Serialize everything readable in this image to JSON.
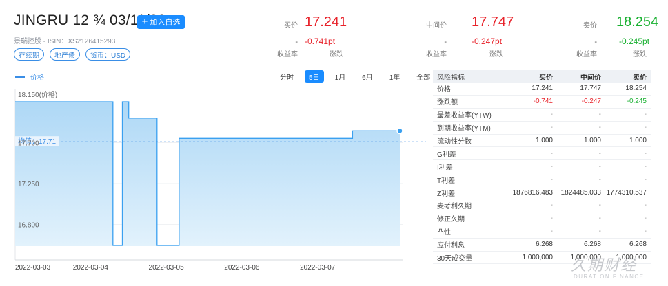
{
  "header": {
    "title": "JINGRU 12 ¾ 03/11/22",
    "add_button_label": "加入自选",
    "issuer_line": "景瑞控股 - ISIN：XS2126415293",
    "tags": [
      "存续期",
      "地产债",
      "货币：USD"
    ]
  },
  "quotes": [
    {
      "label": "买价",
      "price": "17.241",
      "dash": "-",
      "change": "-0.741pt",
      "yield_label": "收益率",
      "change_label": "涨跌",
      "color": "#e8222a"
    },
    {
      "label": "中间价",
      "price": "17.747",
      "dash": "-",
      "change": "-0.247pt",
      "yield_label": "收益率",
      "change_label": "涨跌",
      "color": "#e8222a"
    },
    {
      "label": "卖价",
      "price": "18.254",
      "dash": "-",
      "change": "-0.245pt",
      "yield_label": "收益率",
      "change_label": "涨跌",
      "color": "#18b030"
    }
  ],
  "chart_controls": {
    "legend_label": "价格",
    "ranges": [
      "分时",
      "5日",
      "1月",
      "6月",
      "1年",
      "全部"
    ],
    "active_range": "5日"
  },
  "chart_data": {
    "type": "area",
    "series": [
      {
        "name": "价格",
        "points": [
          [
            "2022-03-03 00:00",
            18.15
          ],
          [
            "2022-03-04 07:00",
            18.15
          ],
          [
            "2022-03-04 07:00",
            16.57
          ],
          [
            "2022-03-04 10:00",
            16.57
          ],
          [
            "2022-03-04 10:00",
            18.15
          ],
          [
            "2022-03-04 12:00",
            18.15
          ],
          [
            "2022-03-04 12:00",
            17.97
          ],
          [
            "2022-03-04 21:00",
            17.97
          ],
          [
            "2022-03-04 21:00",
            16.57
          ],
          [
            "2022-03-05 04:00",
            16.57
          ],
          [
            "2022-03-05 04:00",
            17.747
          ],
          [
            "2022-03-07 11:00",
            17.747
          ],
          [
            "2022-03-07 11:00",
            17.83
          ],
          [
            "2022-03-08 02:00",
            17.83
          ]
        ]
      }
    ],
    "average": 17.71,
    "average_label": "均值：17.71",
    "y_top_label": "18.150(价格)",
    "y_ticks": [
      17.7,
      17.25,
      16.8
    ],
    "y_tick_labels": [
      "17.700",
      "17.250",
      "16.800"
    ],
    "ylim": [
      16.57,
      18.15
    ],
    "x_ticks": [
      "2022-03-03",
      "2022-03-04",
      "2022-03-05",
      "2022-03-06",
      "2022-03-07"
    ],
    "xlim": [
      "2022-03-03 00:00",
      "2022-03-08 02:00"
    ],
    "colors": {
      "line": "#3aa0f0",
      "fill_top": "#aed8f6",
      "fill_bottom": "#e2f2fc",
      "average": "#3a8ee6"
    }
  },
  "risk_table": {
    "headers": [
      "风险指标",
      "买价",
      "中间价",
      "卖价"
    ],
    "rows": [
      {
        "label": "价格",
        "buy": "17.241",
        "mid": "17.747",
        "sell": "18.254"
      },
      {
        "label": "涨跌额",
        "buy": "-0.741",
        "mid": "-0.247",
        "sell": "-0.245"
      },
      {
        "label": "最差收益率(YTW)",
        "buy": "-",
        "mid": "-",
        "sell": "-"
      },
      {
        "label": "到期收益率(YTM)",
        "buy": "-",
        "mid": "-",
        "sell": "-"
      },
      {
        "label": "流动性分数",
        "buy": "1.000",
        "mid": "1.000",
        "sell": "1.000"
      },
      {
        "label": "G利差",
        "buy": "-",
        "mid": "-",
        "sell": "-"
      },
      {
        "label": "I利差",
        "buy": "-",
        "mid": "-",
        "sell": "-"
      },
      {
        "label": "T利差",
        "buy": "-",
        "mid": "-",
        "sell": "-"
      },
      {
        "label": "Z利差",
        "buy": "1876816.483",
        "mid": "1824485.033",
        "sell": "1774310.537"
      },
      {
        "label": "麦考利久期",
        "buy": "-",
        "mid": "-",
        "sell": "-"
      },
      {
        "label": "修正久期",
        "buy": "-",
        "mid": "-",
        "sell": "-"
      },
      {
        "label": "凸性",
        "buy": "-",
        "mid": "-",
        "sell": "-"
      },
      {
        "label": "应付利息",
        "buy": "6.268",
        "mid": "6.268",
        "sell": "6.268"
      },
      {
        "label": "30天成交量",
        "buy": "1,000,000",
        "mid": "1,000,000",
        "sell": "1,000,000"
      }
    ],
    "change_colors": {
      "buy": "#e8222a",
      "mid": "#e8222a",
      "sell": "#18b030"
    }
  },
  "watermark": {
    "cn": "久期财经",
    "en": "DURATION FINANCE"
  }
}
